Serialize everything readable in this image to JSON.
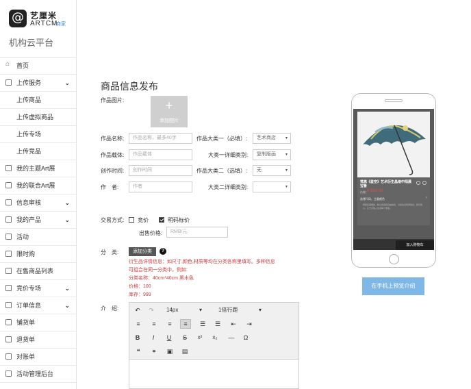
{
  "brand": {
    "logo_glyph": "@",
    "name_cn": "艺厘米",
    "name_en": "ARTCM",
    "tag": "商家",
    "platform": "机构云平台"
  },
  "sidebar": {
    "items": [
      {
        "label": "首页",
        "icon": "home-icon",
        "has_arrow": false
      },
      {
        "label": "上传服务",
        "icon": "upload-icon",
        "has_arrow": true,
        "chevron": "⌄"
      },
      {
        "label": "上传商品",
        "sub": true
      },
      {
        "label": "上传虚拟商品",
        "sub": true
      },
      {
        "label": "上传专场",
        "sub": true
      },
      {
        "label": "上传竞品",
        "sub": true
      },
      {
        "label": "我的主题Art展",
        "icon": "theme-icon",
        "has_arrow": false
      },
      {
        "label": "我的联合Art展",
        "icon": "joint-icon",
        "has_arrow": false
      },
      {
        "label": "信息审核",
        "icon": "audit-icon",
        "has_arrow": true,
        "chevron": "⌄"
      },
      {
        "label": "我的产品",
        "icon": "product-icon",
        "has_arrow": true,
        "chevron": "⌄"
      },
      {
        "label": "活动",
        "icon": "activity-icon",
        "has_arrow": false
      },
      {
        "label": "限时购",
        "icon": "flash-icon",
        "has_arrow": false
      },
      {
        "label": "在售商品列表",
        "icon": "list-icon",
        "has_arrow": false
      },
      {
        "label": "竞价专场",
        "icon": "bid-icon",
        "has_arrow": true,
        "chevron": "⌄"
      },
      {
        "label": "订单信息",
        "icon": "order-icon",
        "has_arrow": true,
        "chevron": "⌄"
      },
      {
        "label": "铺货单",
        "icon": "doc-icon",
        "has_arrow": false
      },
      {
        "label": "退货单",
        "icon": "doc-icon",
        "has_arrow": false
      },
      {
        "label": "对账单",
        "icon": "doc-icon",
        "has_arrow": false
      },
      {
        "label": "活动管理后台",
        "icon": "admin-icon",
        "has_arrow": false
      }
    ]
  },
  "form": {
    "title": "商品信息发布",
    "image_label": "作品图片:",
    "upload_plus": "+",
    "upload_text": "添加图片",
    "name_label": "作品名称:",
    "name_placeholder": "作品名称，最多40字",
    "carrier_label": "作品载体:",
    "carrier_placeholder": "作品载体",
    "time_label": "创作时间:",
    "time_placeholder": "创作时间",
    "author_label": "作　者:",
    "author_placeholder": "作者",
    "cat1_label": "作品大类一（必填）:",
    "cat1_value": "艺术商店",
    "cat1_detail_label": "大类一详细类别:",
    "cat1_detail_value": "复制版画",
    "cat2_label": "作品大类二（选填）:",
    "cat2_value": "无",
    "cat2_detail_label": "大类二详细类别:",
    "cat2_detail_value": "",
    "select_arrow": "▾",
    "trade_label": "交易方式:",
    "trade_bid": "竞价",
    "trade_fixed": "明码标价",
    "price_label": "出售价格:",
    "price_placeholder": "RMB/元",
    "category_label": "分　类:",
    "add_category": "添加分类",
    "help_glyph": "?",
    "notes": [
      "衍生品详情信息：如尺寸,颜色,材质等均在分类各称里填写。多种信息",
      "可组合在同一分类中，例如:",
      "分类名称：40cm*40cm 黑木色",
      "价格：100",
      "库存：999"
    ],
    "intro_label": "介　绍:"
  },
  "editor": {
    "undo": "↶",
    "redo": "↷",
    "font_size": "14px",
    "line_height": "1倍行距",
    "dropdown": "▾",
    "row2": [
      "≡",
      "≡",
      "≡",
      "≡",
      "☰",
      "☰",
      "⇤",
      "⇥"
    ],
    "bold": "B",
    "italic": "I",
    "underline": "U",
    "strike": "S",
    "superscript": "x²",
    "subscript": "x₂",
    "hr": "—",
    "omega": "Ω",
    "quote": "❝",
    "link": "⚭",
    "image": "▣",
    "video": "▤"
  },
  "phone": {
    "product_name": "梵高《星空》艺术衍生晶雨中阳晨宝鲁",
    "price_label": "价格：",
    "price": "¥ 580.00",
    "spec": "选择尺码、主要颜色",
    "spec_arrow": "›",
    "desc": "按照您需要的，精心挑选和自由组合，为您生活增添色彩；我们用心，让艺术融入生活每个角落。",
    "cart": "加入购物车",
    "preview_button": "在手机上预览介绍"
  }
}
